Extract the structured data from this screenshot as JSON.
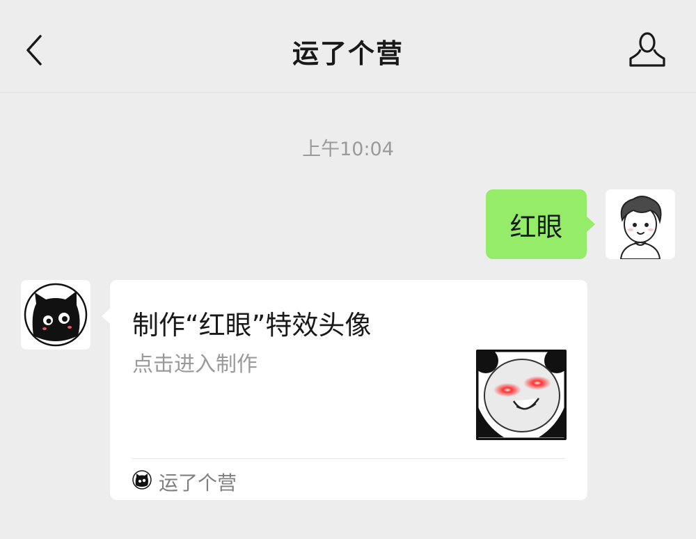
{
  "header": {
    "title": "运了个营",
    "back_icon": "chevron-left-icon",
    "profile_icon": "person-icon"
  },
  "chat": {
    "timestamp": "上午10:04",
    "messages": [
      {
        "sender": "me",
        "type": "text",
        "text": "红眼",
        "avatar_icon": "cartoon-boy-avatar"
      },
      {
        "sender": "bot",
        "type": "mini-program-card",
        "avatar_icon": "black-cat-avatar",
        "title": "制作“红眼”特效头像",
        "description": "点击进入制作",
        "thumbnail": "panda-red-eyes-meme",
        "source_name": "运了个营",
        "source_icon": "black-cat-icon"
      }
    ]
  },
  "colors": {
    "background": "#ededed",
    "my_bubble": "#95ec69",
    "card": "#ffffff",
    "muted_text": "#9a9a9a"
  }
}
